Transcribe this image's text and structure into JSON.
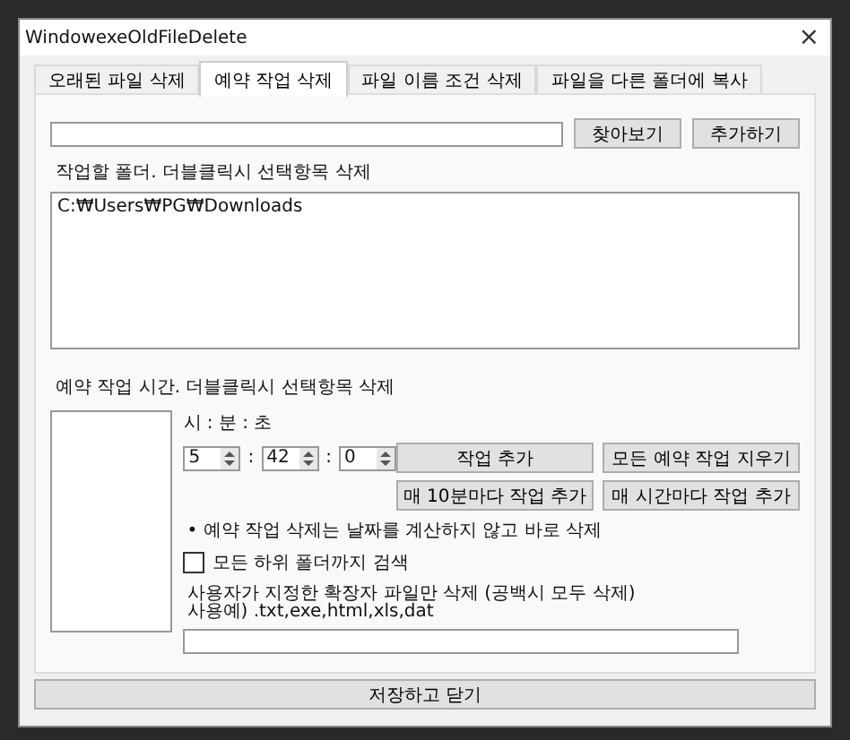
{
  "window": {
    "title": "WindowexeOldFileDelete",
    "close": "×"
  },
  "tabs": [
    {
      "label": "오래된 파일 삭제",
      "selected": false
    },
    {
      "label": "예약 작업 삭제",
      "selected": true
    },
    {
      "label": "파일 이름 조건 삭제",
      "selected": false
    },
    {
      "label": "파일을 다른 폴더에 복사",
      "selected": false
    }
  ],
  "folders": {
    "browse_button": "찾아보기",
    "add_button": "추가하기",
    "list_label": "작업할 폴더. 더블클릭시 선택항목 삭제",
    "items": [
      "C:₩Users₩PG₩Downloads"
    ]
  },
  "schedule": {
    "label": "예약 작업 시간. 더블클릭시 선택항목 삭제",
    "time_label": "시 : 분 : 초",
    "hour": "5",
    "minute": "42",
    "second": "0",
    "separators": [
      ":",
      ":"
    ],
    "buttons": [
      "작업 추가",
      "모든 예약 작업 지우기",
      "매 10분마다 작업 추가",
      "매 시간마다 작업 추가"
    ],
    "note": "• 예약 작업 삭제는 날짜를 계산하지 않고 바로 삭제",
    "subfolders": {
      "label": "모든 하위 폴더까지 검색",
      "checked": false
    },
    "extensions": {
      "label": "사용자가 지정한 확장자 파일만 삭제 (공백시 모두 삭제)",
      "example": "사용예) .txt,exe,html,xls,dat"
    }
  },
  "save_button": "저장하고 닫기"
}
